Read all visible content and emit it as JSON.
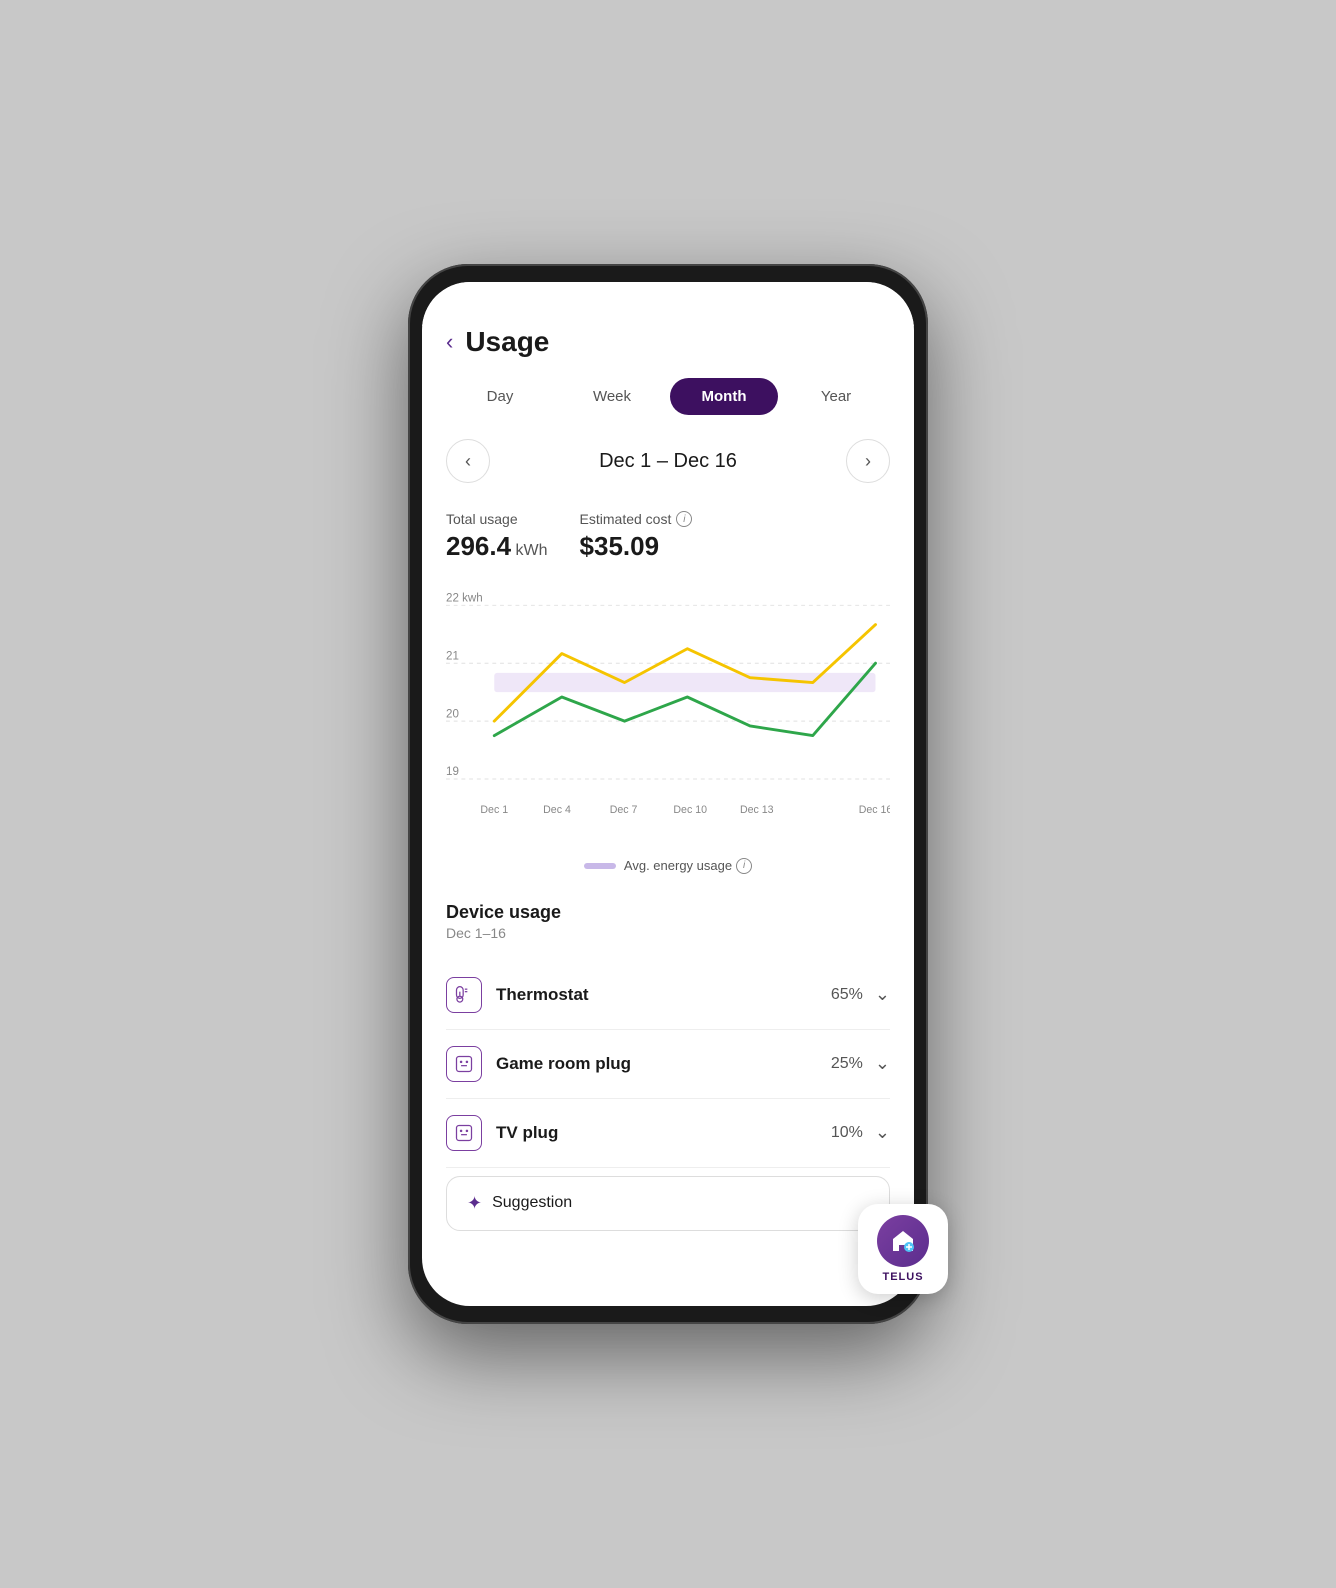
{
  "header": {
    "back_label": "‹",
    "title": "Usage"
  },
  "tabs": [
    {
      "id": "day",
      "label": "Day",
      "active": false
    },
    {
      "id": "week",
      "label": "Week",
      "active": false
    },
    {
      "id": "month",
      "label": "Month",
      "active": true
    },
    {
      "id": "year",
      "label": "Year",
      "active": false
    }
  ],
  "date_nav": {
    "prev_label": "‹",
    "next_label": "›",
    "range": "Dec 1 – Dec 16"
  },
  "stats": {
    "usage_label": "Total usage",
    "usage_value": "296.4",
    "usage_unit": " kWh",
    "cost_label": "Estimated cost",
    "cost_value": "$35.09"
  },
  "chart": {
    "y_labels": [
      "22 kwh",
      "21",
      "20",
      "19"
    ],
    "x_labels": [
      "Dec 1",
      "Dec 4",
      "Dec 7",
      "Dec 10",
      "Dec 13",
      "Dec 16"
    ]
  },
  "legend": {
    "label": "Avg. energy usage"
  },
  "device_usage": {
    "section_title": "Device usage",
    "section_subtitle": "Dec 1–16",
    "devices": [
      {
        "id": "thermostat",
        "name": "Thermostat",
        "pct": "65%",
        "icon": "thermostat"
      },
      {
        "id": "game-room-plug",
        "name": "Game room plug",
        "pct": "25%",
        "icon": "plug"
      },
      {
        "id": "tv-plug",
        "name": "TV plug",
        "pct": "10%",
        "icon": "plug"
      }
    ]
  },
  "suggestion": {
    "label": "Suggestion"
  },
  "telus": {
    "name": "TELUS"
  },
  "colors": {
    "accent": "#3d1060",
    "purple": "#7b3fa0",
    "yellow": "#f5c400",
    "green": "#2ea64a",
    "avg_line": "#c8b8e8"
  }
}
